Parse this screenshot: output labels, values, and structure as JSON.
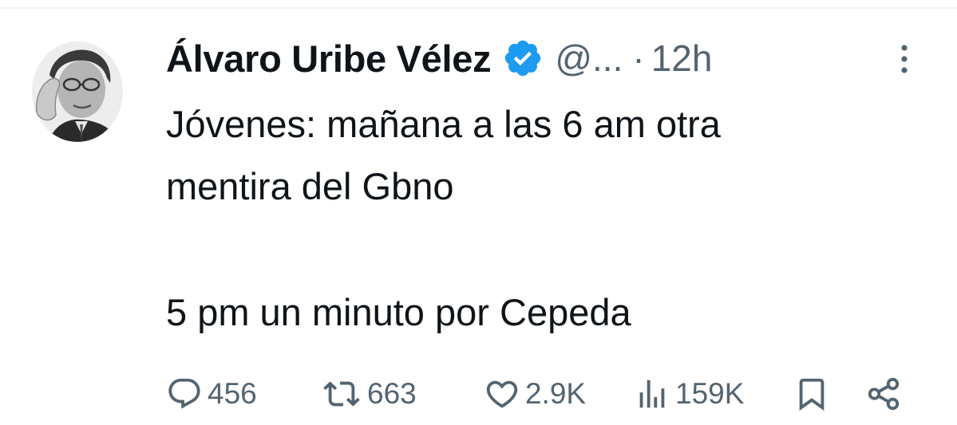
{
  "tweet": {
    "author_name": "Álvaro Uribe Vélez",
    "handle": "@...",
    "separator": "·",
    "time": "12h",
    "text_lines": [
      "Jóvenes: mañana a las 6 am otra",
      "mentira del Gbno",
      "5 pm un minuto por Cepeda"
    ]
  },
  "actions": {
    "reply_count": "456",
    "retweet_count": "663",
    "like_count": "2.9K",
    "views_count": "159K"
  },
  "icons": {
    "verified": "verified-badge-icon",
    "more": "more-vertical-icon",
    "reply": "reply-icon",
    "retweet": "retweet-icon",
    "like": "heart-icon",
    "views": "views-icon",
    "bookmark": "bookmark-icon",
    "share": "share-icon"
  },
  "colors": {
    "verified_blue": "#1d9bf0",
    "text_primary": "#0f1419",
    "text_secondary": "#536471"
  }
}
